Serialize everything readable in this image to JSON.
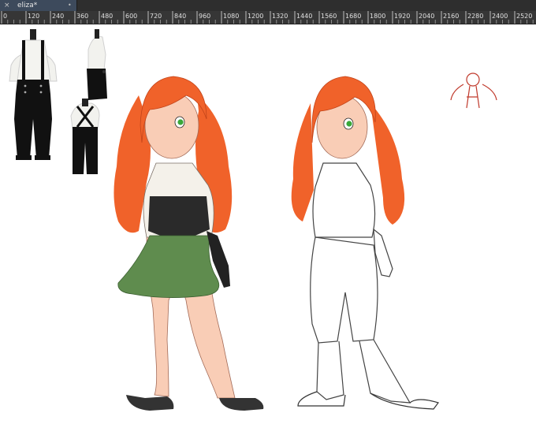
{
  "tab": {
    "title": "eliza*",
    "close": "×",
    "dot": "•"
  },
  "ruler": {
    "labels": [
      "0",
      "120",
      "240",
      "360",
      "480",
      "600",
      "720",
      "840",
      "960",
      "1080",
      "1200",
      "1320",
      "1440",
      "1560",
      "1680",
      "1800",
      "1920",
      "2040",
      "2160",
      "2280",
      "2400",
      "2520"
    ]
  },
  "colors": {
    "hair": "#f0622a",
    "hair_shade": "#d8461a",
    "skin": "#f9cdb6",
    "skirt": "#5f8c4e",
    "corset": "#2a2a2a",
    "eyes": "#39a83a",
    "sketch_red": "#c0392b"
  }
}
